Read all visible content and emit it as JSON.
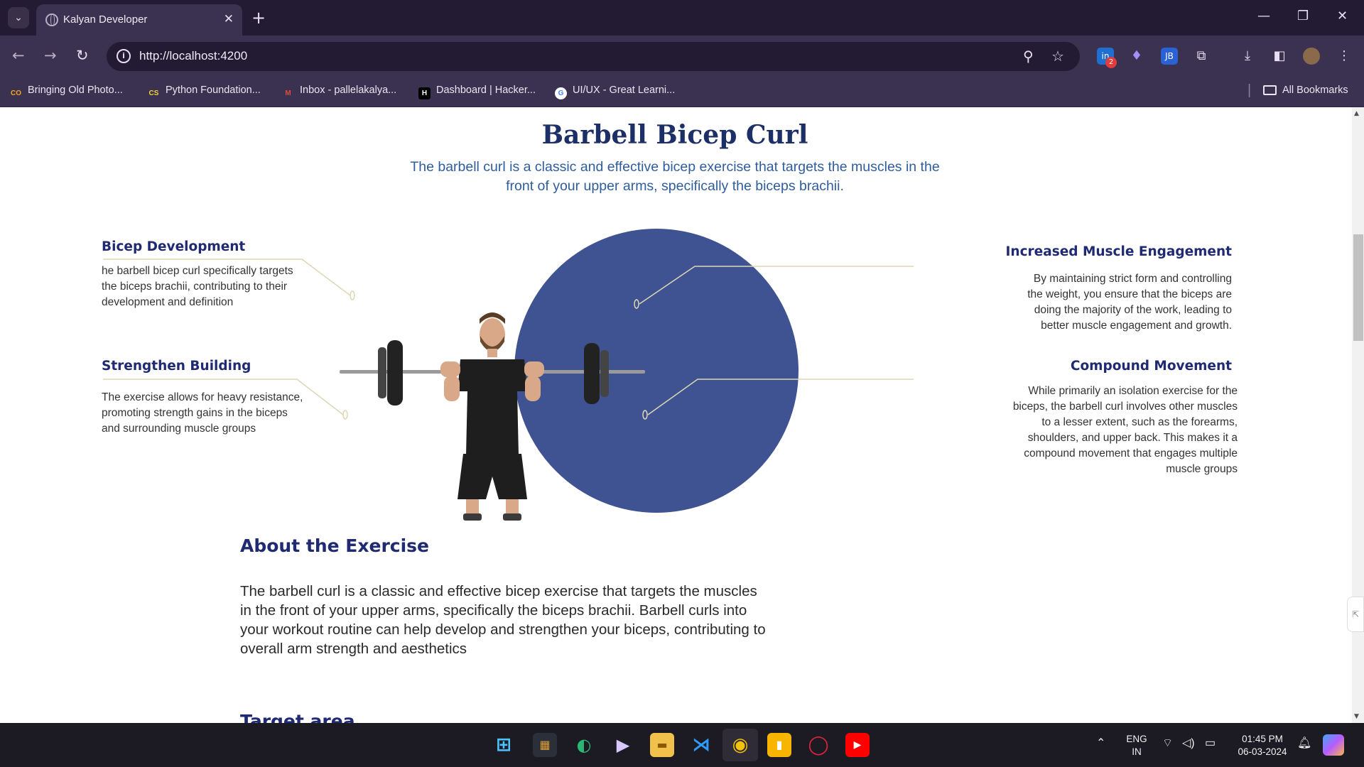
{
  "browser": {
    "tab_title": "Kalyan Developer",
    "url": "http://localhost:4200",
    "bookmarks": [
      "Bringing Old Photo...",
      "Python Foundation...",
      "Inbox - pallelakalya...",
      "Dashboard | Hacker...",
      "UI/UX - Great Learni..."
    ],
    "all_bookmarks": "All Bookmarks",
    "extension_badge": "2"
  },
  "hero": {
    "title": "Barbell Bicep Curl",
    "subtitle": "The barbell curl is a classic and effective bicep exercise that targets the muscles in the front of your upper arms, specifically the biceps brachii."
  },
  "features": {
    "left": [
      {
        "title": "Bicep Development",
        "text": "he barbell bicep curl specifically targets the biceps brachii, contributing to their development and definition"
      },
      {
        "title": "Strengthen Building",
        "text": "The exercise allows for heavy resistance, promoting strength gains in the biceps and surrounding muscle groups"
      }
    ],
    "right": [
      {
        "title": "Increased Muscle Engagement",
        "text": "By maintaining strict form and controlling the weight, you ensure that the biceps are doing the majority of the work, leading to better muscle engagement and growth."
      },
      {
        "title": "Compound Movement",
        "text": "While primarily an isolation exercise for the biceps, the barbell curl involves other muscles to a lesser extent, such as the forearms, shoulders, and upper back. This makes it a compound movement that engages multiple muscle groups"
      }
    ]
  },
  "about": {
    "title": "About the Exercise",
    "text": "The barbell curl is a classic and effective bicep exercise that targets the muscles in the front of your upper arms, specifically the biceps brachii. Barbell curls into your workout routine can help develop and strengthen your biceps, contributing to overall arm strength and aesthetics"
  },
  "target": {
    "title": "Target area"
  },
  "taskbar": {
    "lang_top": "ENG",
    "lang_bottom": "IN",
    "time": "01:45 PM",
    "date": "06-03-2024"
  },
  "colors": {
    "accent_circle": "#3f5291",
    "heading": "#1f2a72",
    "subtitle": "#2f5d9c",
    "connector_line": "#ddd7b4"
  }
}
